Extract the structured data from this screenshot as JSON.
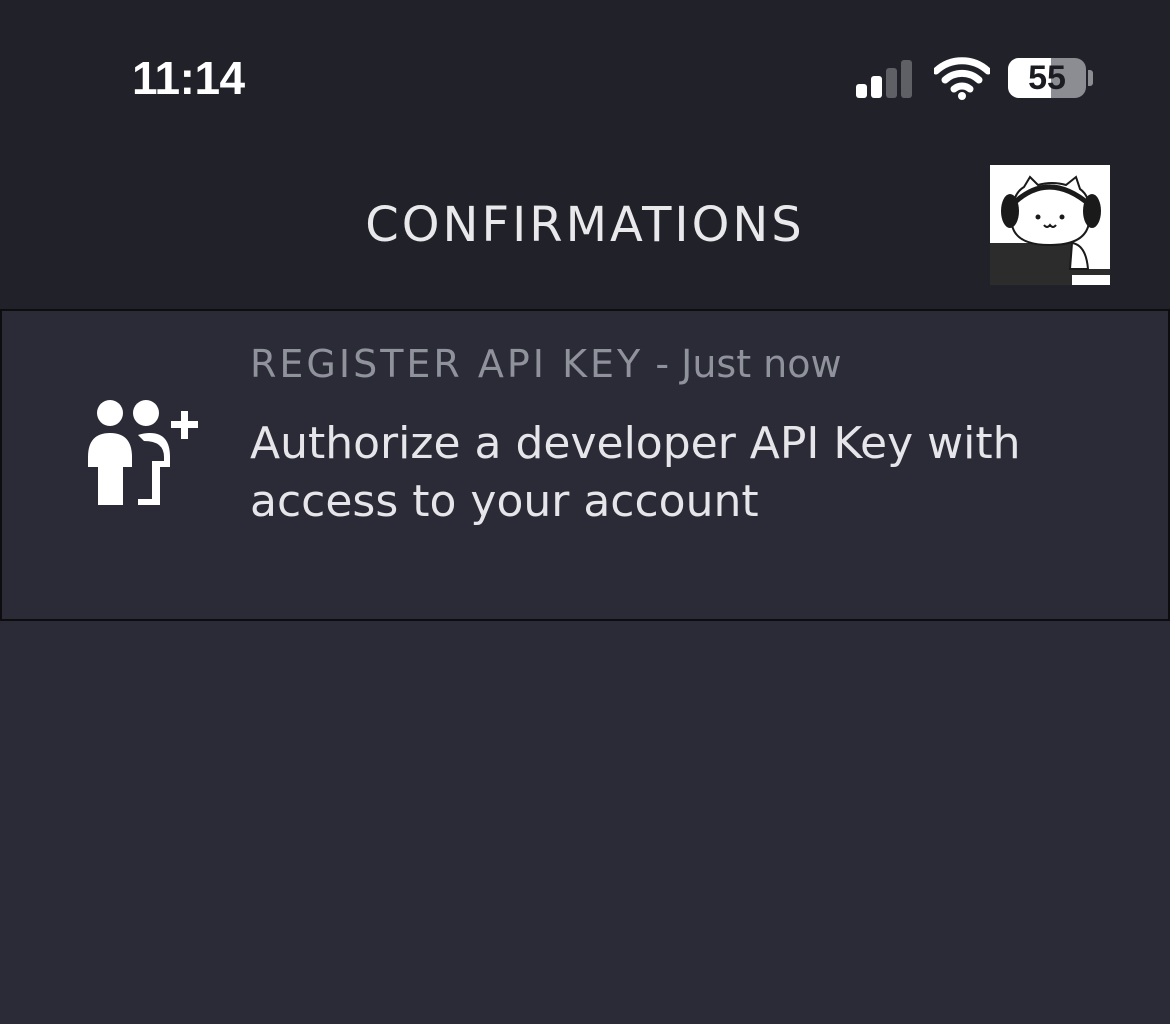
{
  "status_bar": {
    "time": "11:14",
    "signal_bars_active": 2,
    "signal_bars_total": 4,
    "battery_percent": 55,
    "battery_label": "55"
  },
  "header": {
    "title": "CONFIRMATIONS",
    "avatar_icon": "cat-with-headphones-avatar"
  },
  "confirmations": [
    {
      "type": "REGISTER API KEY",
      "separator": " - ",
      "time": "Just now",
      "description": "Authorize a developer API Key with access to your account",
      "icon": "add-users-icon"
    }
  ],
  "colors": {
    "header_bg": "#212229",
    "page_bg": "#2a2b36",
    "meta_text": "#8f919b",
    "body_text": "#e6e6ea"
  }
}
